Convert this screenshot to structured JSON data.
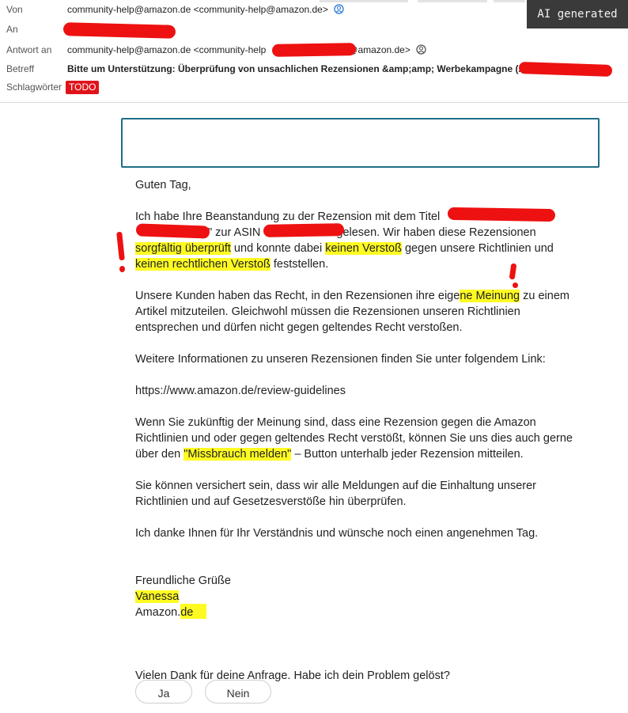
{
  "header": {
    "from_label": "Von",
    "from_value": "community-help@amazon.de <community-help@amazon.de>",
    "to_label": "An",
    "reply_label": "Antwort an",
    "reply_prefix": "community-help@amazon.de <community-help",
    "reply_suffix": "@amazon.de>",
    "subject_label": "Betreff",
    "subject_value": "Bitte um Unterstützung: Überprüfung von unsachlichen Rezensionen &amp;amp; Werbekampagne (ASIN",
    "tags_label": "Schlagwörter",
    "tag": "TODO"
  },
  "badge": {
    "text": "AI generated"
  },
  "body": {
    "greeting": "Guten Tag,",
    "p1_a": "Ich habe Ihre Beanstandung zu der Rezension mit dem Titel",
    "p1_b": "\" zur ASIN",
    "p1_c": "gelesen. Wir haben diese Rezensionen",
    "p1_h1": "sorgfältig überprüft",
    "p1_d": " und konnte dabei ",
    "p1_h2": "keinen Verstoß",
    "p1_e": " gegen unsere Richtlinien und",
    "p1_h3": "keinen rechtlichen Verstoß",
    "p1_f": " feststellen.",
    "p2_a": "Unsere Kunden haben das Recht, in den Rezensionen ihre eige",
    "p2_h": "ne Meinung",
    "p2_b": " zu einem Artikel mitzuteilen. Gleichwohl müssen die Rezensionen unseren Richtlinien entsprechen und dürfen nicht gegen geltendes Recht verstoßen.",
    "p3": "Weitere Informationen zu unseren Rezensionen finden Sie unter folgendem Link:",
    "link": "https://www.amazon.de/review-guidelines",
    "p4_a": "Wenn Sie zukünftig der Meinung sind, dass eine Rezension gegen die Amazon Richtlinien und oder gegen geltendes Recht verstößt, können Sie uns dies auch gerne über den ",
    "p4_h": "\"Missbrauch melden\"",
    "p4_b": " – Button unterhalb jeder Rezension mitteilen.",
    "p5": "Sie können versichert sein, dass wir alle Meldungen auf die Einhaltung unserer Richtlinien und auf Gesetzesverstöße hin überprüfen.",
    "p6": "Ich danke Ihnen für Ihr Verständnis und wünsche noch einen angenehmen Tag.",
    "closing": "Freundliche Grüße",
    "name": "Vanessa",
    "company": "Amazon.de",
    "question": "Vielen Dank für deine Anfrage. Habe ich dein Problem gelöst?"
  },
  "buttons": {
    "yes": "Ja",
    "no": "Nein"
  },
  "colors": {
    "highlight": "#fffb22",
    "redaction": "#ee1111",
    "tag": "#e0131b",
    "box_border": "#1f6e88"
  }
}
